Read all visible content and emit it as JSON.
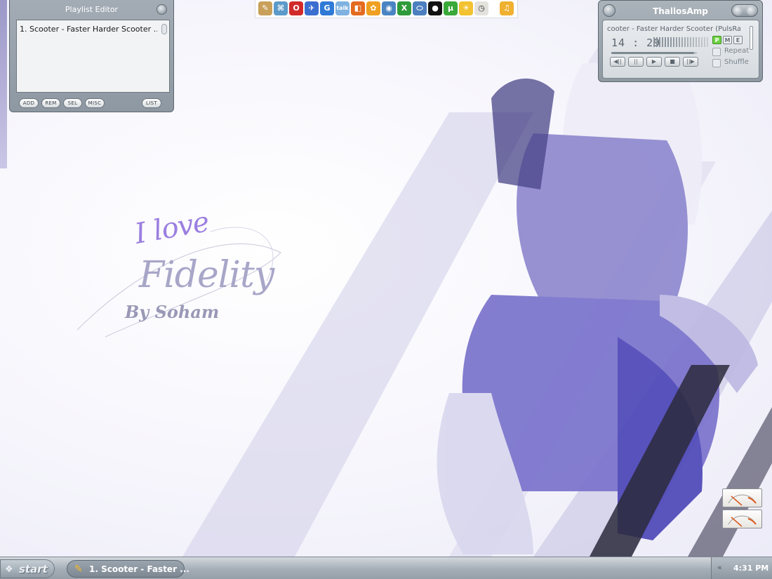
{
  "wallpaper": {
    "line1": "I love",
    "line2": "Fidelity",
    "line3": "By Soham"
  },
  "playlist_editor": {
    "title": "Playlist Editor",
    "items": [
      "1. Scooter - Faster Harder Scooter ..."
    ],
    "buttons": {
      "add": "ADD",
      "rem": "REM",
      "sel": "SEL",
      "misc": "MISC",
      "list": "LIST"
    }
  },
  "quick_launch": {
    "icons": [
      "pencil-icon",
      "network-icon",
      "opera-icon",
      "kite-icon",
      "google-g-icon",
      "gtalk-icon",
      "map-icon",
      "paint-icon",
      "camera-icon",
      "xbox-icon",
      "drive-icon",
      "messenger-icon",
      "utorrent-icon",
      "sun-icon",
      "clock-icon",
      "media-player-icon"
    ]
  },
  "player": {
    "title": "ThallosAmp",
    "song": "cooter - Faster Harder Scooter (PulsRa",
    "time": "14 : 29",
    "mode_buttons": [
      "P",
      "M",
      "E"
    ],
    "active_mode": "P",
    "seek_progress": 0.97,
    "controls": [
      "◀||",
      "||",
      "▶",
      "■",
      "||▶"
    ],
    "repeat_label": "Repeat",
    "shuffle_label": "Shuffle"
  },
  "taskbar": {
    "start_label": "start",
    "task_label": "1. Scooter - Faster ...",
    "tray_chevron": "«",
    "clock": "4:31 PM"
  },
  "colors": {
    "accent_purple": "#5a54c8",
    "skin_gray": "#9aa4ad",
    "active_green": "#6dd244"
  }
}
